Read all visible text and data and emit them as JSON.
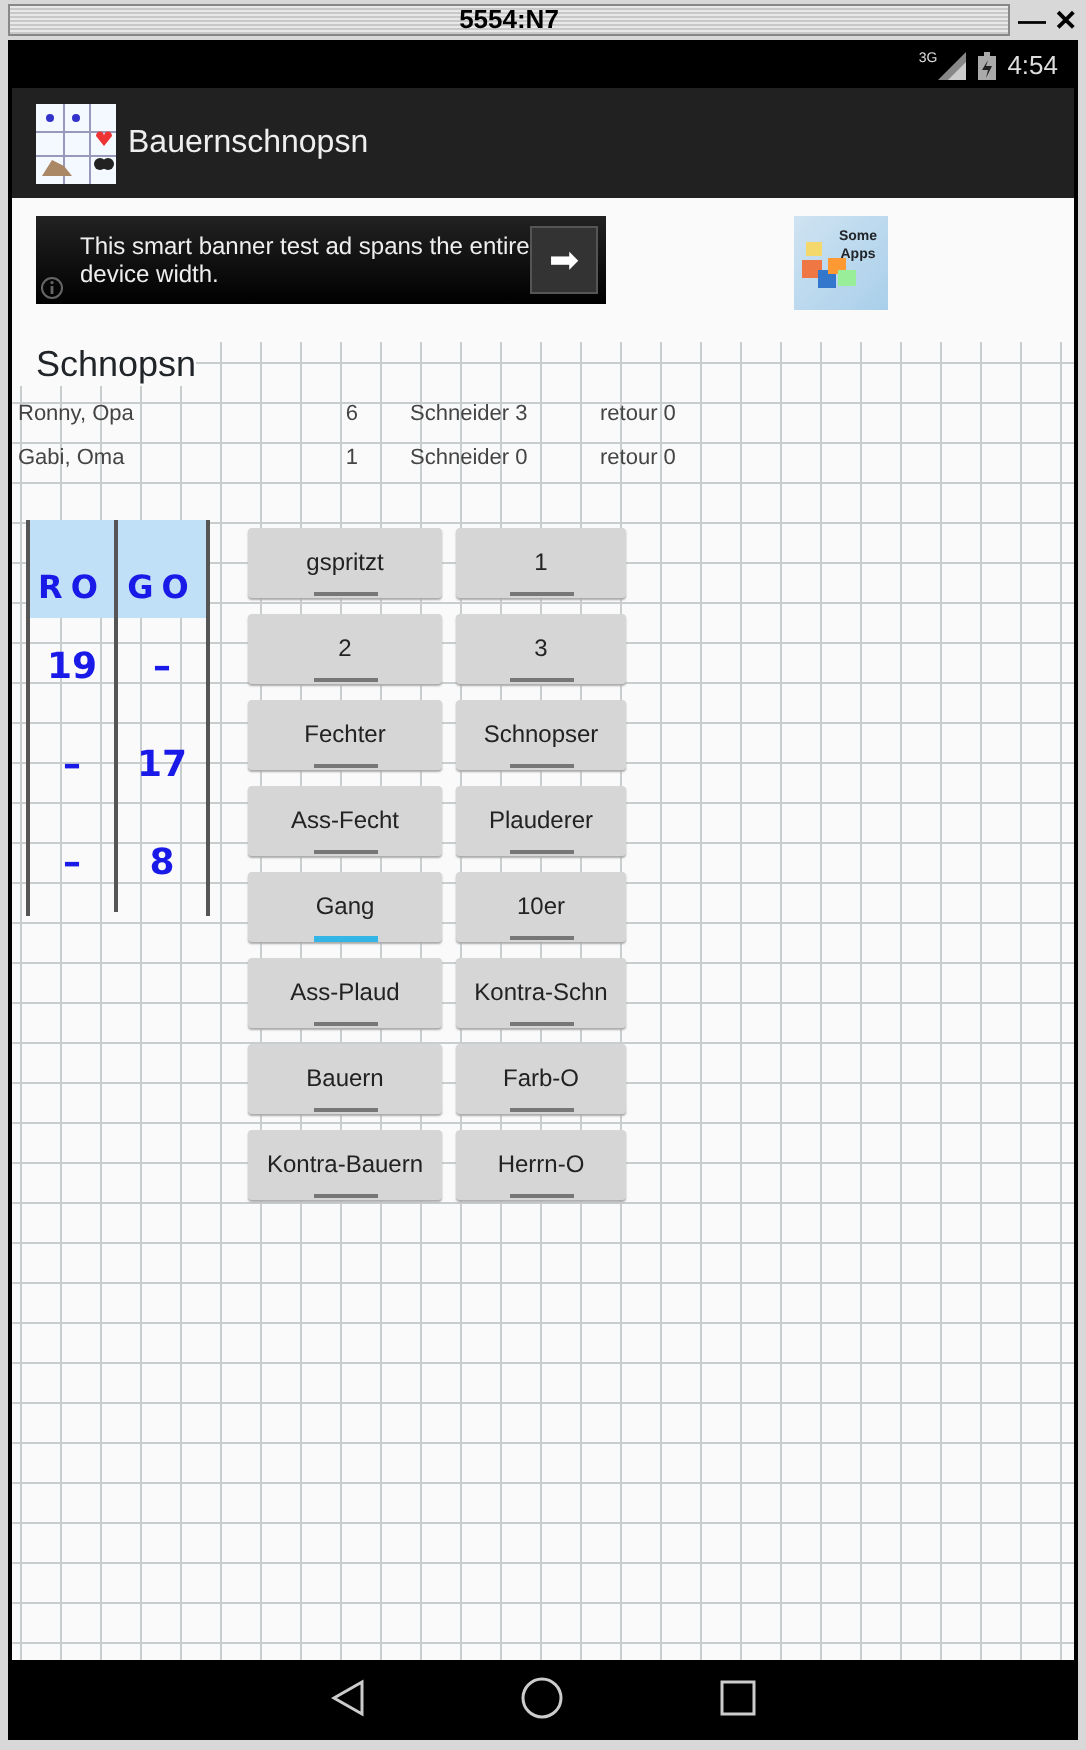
{
  "window": {
    "title": "5554:N7",
    "controls": [
      "—",
      "✕"
    ]
  },
  "status_bar": {
    "network": "3G",
    "time": "4:54"
  },
  "app_bar": {
    "title": "Bauernschnopsn"
  },
  "ad": {
    "text": "This smart banner test ad spans the entire device width.",
    "arrow": "➡"
  },
  "promo": {
    "label": "Some Apps"
  },
  "section": {
    "title": "Schnopsn"
  },
  "players": [
    {
      "name": "Ronny, Opa",
      "points": "6",
      "schneider": "Schneider 3",
      "retour": "retour 0"
    },
    {
      "name": "Gabi, Oma",
      "points": "1",
      "schneider": "Schneider 0",
      "retour": "retour 0"
    }
  ],
  "score_table": {
    "columns": [
      "RO",
      "GO"
    ],
    "rows": [
      [
        "19",
        "–"
      ],
      [
        "–",
        "17"
      ],
      [
        "–",
        "8"
      ]
    ]
  },
  "toggles": [
    {
      "label": "gspritzt",
      "on": false
    },
    {
      "label": "1",
      "on": false
    },
    {
      "label": "2",
      "on": false
    },
    {
      "label": "3",
      "on": false
    },
    {
      "label": "Fechter",
      "on": false
    },
    {
      "label": "Schnopser",
      "on": false
    },
    {
      "label": "Ass-Fecht",
      "on": false
    },
    {
      "label": "Plauderer",
      "on": false
    },
    {
      "label": "Gang",
      "on": true
    },
    {
      "label": "10er",
      "on": false
    },
    {
      "label": "Ass-Plaud",
      "on": false
    },
    {
      "label": "Kontra-Schn",
      "on": false
    },
    {
      "label": "Bauern",
      "on": false
    },
    {
      "label": "Farb-O",
      "on": false
    },
    {
      "label": "Kontra-Bauern",
      "on": false
    },
    {
      "label": "Herrn-O",
      "on": false
    }
  ]
}
